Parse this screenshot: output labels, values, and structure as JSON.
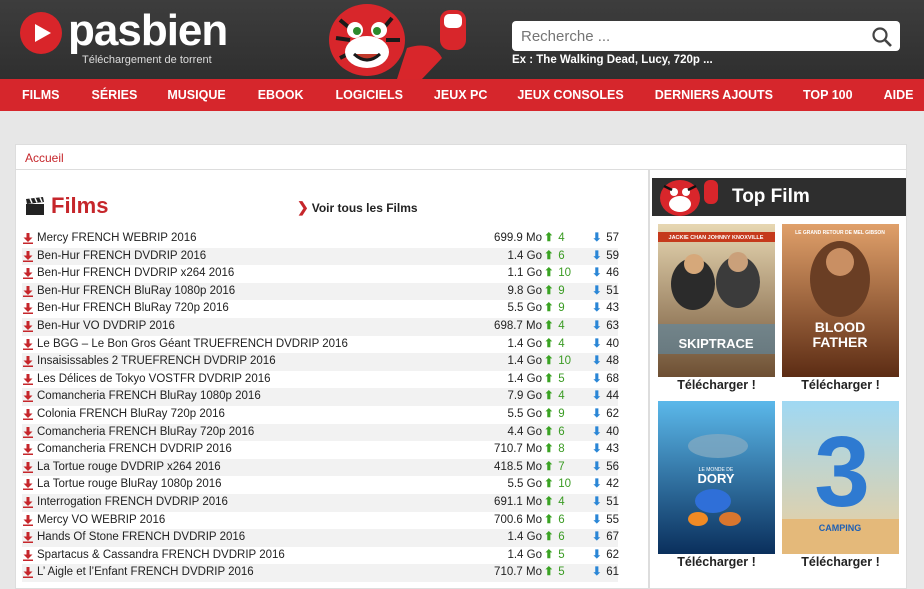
{
  "header": {
    "logo_text": "pasbien",
    "logo_subtitle": "Téléchargement de torrent",
    "search_placeholder": "Recherche ...",
    "search_example": "Ex : The Walking Dead, Lucy, 720p ..."
  },
  "nav": [
    "FILMS",
    "SÉRIES",
    "MUSIQUE",
    "EBOOK",
    "LOGICIELS",
    "JEUX PC",
    "JEUX CONSOLES",
    "DERNIERS AJOUTS",
    "TOP 100",
    "AIDE"
  ],
  "breadcrumb": "Accueil",
  "films": {
    "title": "Films",
    "see_all": "Voir tous les Films",
    "rows": [
      {
        "name": "Mercy FRENCH WEBRIP 2016",
        "size": "699.9 Mo",
        "seeds": "4",
        "leech": "57"
      },
      {
        "name": "Ben-Hur FRENCH DVDRIP 2016",
        "size": "1.4 Go",
        "seeds": "6",
        "leech": "59"
      },
      {
        "name": "Ben-Hur FRENCH DVDRIP x264 2016",
        "size": "1.1 Go",
        "seeds": "10",
        "leech": "46"
      },
      {
        "name": "Ben-Hur FRENCH BluRay 1080p 2016",
        "size": "9.8 Go",
        "seeds": "9",
        "leech": "51"
      },
      {
        "name": "Ben-Hur FRENCH BluRay 720p 2016",
        "size": "5.5 Go",
        "seeds": "9",
        "leech": "43"
      },
      {
        "name": "Ben-Hur VO DVDRIP 2016",
        "size": "698.7 Mo",
        "seeds": "4",
        "leech": "63"
      },
      {
        "name": "Le BGG – Le Bon Gros Géant TRUEFRENCH DVDRIP 2016",
        "size": "1.4 Go",
        "seeds": "4",
        "leech": "40"
      },
      {
        "name": "Insaisissables 2 TRUEFRENCH DVDRIP 2016",
        "size": "1.4 Go",
        "seeds": "10",
        "leech": "48"
      },
      {
        "name": "Les Délices de Tokyo VOSTFR DVDRIP 2016",
        "size": "1.4 Go",
        "seeds": "5",
        "leech": "68"
      },
      {
        "name": "Comancheria FRENCH BluRay 1080p 2016",
        "size": "7.9 Go",
        "seeds": "4",
        "leech": "44"
      },
      {
        "name": "Colonia FRENCH BluRay 720p 2016",
        "size": "5.5 Go",
        "seeds": "9",
        "leech": "62"
      },
      {
        "name": "Comancheria FRENCH BluRay 720p 2016",
        "size": "4.4 Go",
        "seeds": "6",
        "leech": "40"
      },
      {
        "name": "Comancheria FRENCH DVDRIP 2016",
        "size": "710.7 Mo",
        "seeds": "8",
        "leech": "43"
      },
      {
        "name": "La Tortue rouge DVDRIP x264 2016",
        "size": "418.5 Mo",
        "seeds": "7",
        "leech": "56"
      },
      {
        "name": "La Tortue rouge BluRay 1080p 2016",
        "size": "5.5 Go",
        "seeds": "10",
        "leech": "42"
      },
      {
        "name": "Interrogation FRENCH DVDRIP 2016",
        "size": "691.1 Mo",
        "seeds": "4",
        "leech": "51"
      },
      {
        "name": "Mercy VO WEBRIP 2016",
        "size": "700.6 Mo",
        "seeds": "6",
        "leech": "55"
      },
      {
        "name": "Hands Of Stone FRENCH DVDRIP 2016",
        "size": "1.4 Go",
        "seeds": "6",
        "leech": "67"
      },
      {
        "name": "Spartacus & Cassandra FRENCH DVDRIP 2016",
        "size": "1.4 Go",
        "seeds": "5",
        "leech": "62"
      },
      {
        "name": "L’ Aigle et l’Enfant FRENCH DVDRIP 2016",
        "size": "710.7 Mo",
        "seeds": "5",
        "leech": "61"
      }
    ]
  },
  "top_film": {
    "title": "Top Film",
    "download_label": "Télécharger !",
    "posters": [
      {
        "title": "SKIPTRACE",
        "tagline": "JACKIE CHAN   JOHNNY KNOXVILLE",
        "colors": [
          "#d7c7a0",
          "#7a5a3a"
        ]
      },
      {
        "title": "BLOOD FATHER",
        "tagline": "LE GRAND RETOUR DE MEL GIBSON",
        "colors": [
          "#c97a3c",
          "#6b3418"
        ]
      },
      {
        "title": "DORY",
        "tagline": "LE MONDE DE",
        "colors": [
          "#2b8fd1",
          "#0b3b6d"
        ]
      },
      {
        "title": "CAMPING",
        "tagline": "3",
        "colors": [
          "#6fc3ee",
          "#e6c38a"
        ]
      }
    ]
  },
  "colors": {
    "brand_red": "#d6262c",
    "header_dark": "#333333",
    "seed_green": "#3aa323",
    "leech_blue": "#2a86d6"
  }
}
